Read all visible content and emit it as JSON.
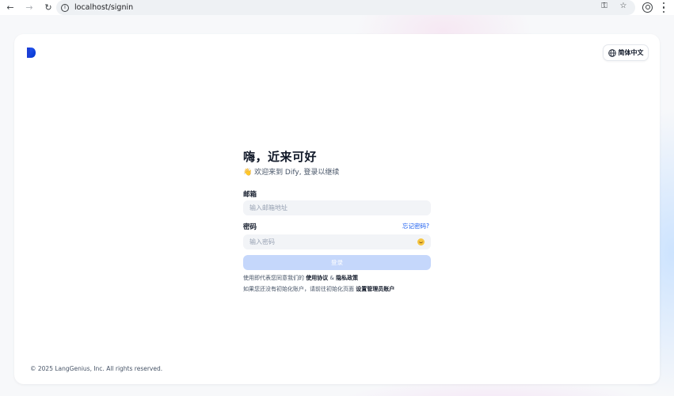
{
  "browser": {
    "url": "localhost/signin",
    "info_glyph": "i"
  },
  "header": {
    "language_label": "简体中文"
  },
  "login": {
    "title": "嗨，近来可好",
    "subtitle": "👋 欢迎来到 Dify, 登录以继续",
    "email_label": "邮箱",
    "email_placeholder": "输入邮箱地址",
    "password_label": "密码",
    "forgot_password": "忘记密码?",
    "password_placeholder": "输入密码",
    "submit_label": "登录"
  },
  "terms": {
    "prefix": "使用即代表您同意我们的",
    "terms_link": "使用协议",
    "separator": " & ",
    "privacy_link": "隐私政策",
    "init_prefix": "如果您还没有初始化账户，请前往初始化页面",
    "init_link": "设置管理员账户"
  },
  "footer": {
    "copyright": "© 2025 LangGenius, Inc. All rights reserved."
  },
  "colors": {
    "accent": "#155aef",
    "button_disabled": "#c5d7fb",
    "input_bg": "#f2f4f7"
  }
}
